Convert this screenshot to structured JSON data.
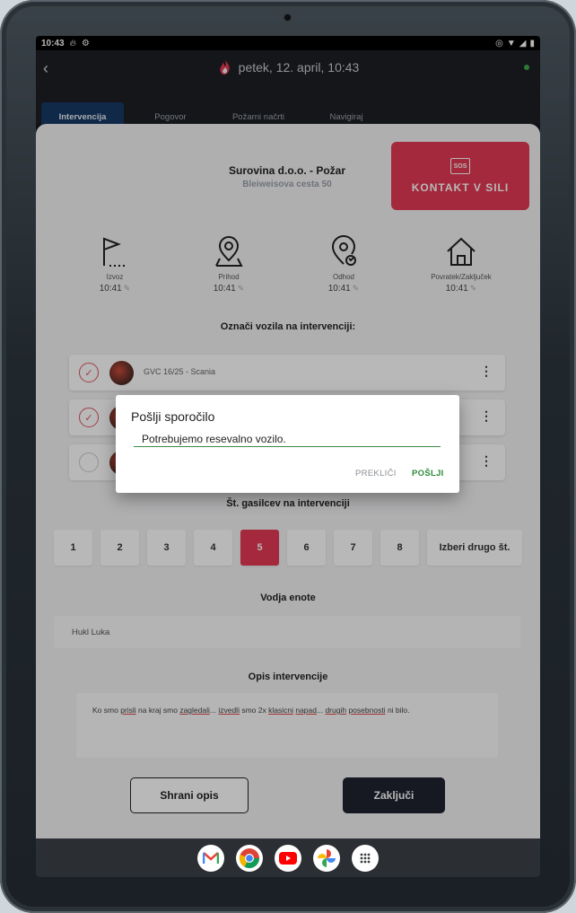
{
  "status_bar": {
    "time": "10:43",
    "left_icons": [
      "flame-icon",
      "settings-icon"
    ],
    "right_icons": [
      "location-icon",
      "wifi-icon",
      "signal-icon",
      "battery-icon"
    ]
  },
  "app_bar": {
    "title": "petek, 12. april, 10:43",
    "online_color": "#3fa84a"
  },
  "tabs": [
    {
      "label": "Intervencija",
      "active": true
    },
    {
      "label": "Pogovor",
      "active": false
    },
    {
      "label": "Požarni načrti",
      "active": false
    },
    {
      "label": "Navigiraj",
      "active": false
    }
  ],
  "incident": {
    "title": "Surovina d.o.o. - Požar",
    "address": "Bleiweisova cesta 50"
  },
  "sos": {
    "badge": "SOS",
    "label": "KONTAKT V SILI",
    "color": "#e33a54"
  },
  "steps": [
    {
      "icon": "flag-icon",
      "label": "Izvoz",
      "time": "10:41"
    },
    {
      "icon": "location-pin-icon",
      "label": "Prihod",
      "time": "10:41"
    },
    {
      "icon": "location-return-icon",
      "label": "Odhod",
      "time": "10:41"
    },
    {
      "icon": "home-icon",
      "label": "Povratek/Zaključek",
      "time": "10:41"
    }
  ],
  "vehicles_heading": "Označi vozila na intervenciji:",
  "vehicles": [
    {
      "name": "GVC 16/25 - Scania",
      "checked": true
    },
    {
      "name": "",
      "checked": true
    },
    {
      "name": "",
      "checked": false
    }
  ],
  "firefighters_heading": "Št. gasilcev na intervenciji",
  "numbers": [
    "1",
    "2",
    "3",
    "4",
    "5",
    "6",
    "7",
    "8"
  ],
  "selected_number": "5",
  "other_number_label": "Izberi drugo št.",
  "leader_heading": "Vodja enote",
  "leader_value": "Hukl Luka",
  "description_heading": "Opis intervencije",
  "description_parts": [
    "Ko smo ",
    "prisli",
    " na kraj smo ",
    "zagledali",
    "... ",
    "izvedli",
    " smo 2x ",
    "klasicni",
    " ",
    "napad",
    "... ",
    "drugih",
    " ",
    "posebnosti",
    " ni bilo."
  ],
  "buttons": {
    "save": "Shrani opis",
    "finish": "Zaključi"
  },
  "dialog": {
    "title": "Pošlji sporočilo",
    "input_value": "Potrebujemo resevalno vozilo.",
    "cancel": "PREKLIČI",
    "send": "POŠLJI"
  },
  "dock_apps": [
    "gmail-icon",
    "chrome-icon",
    "youtube-icon",
    "photos-icon",
    "app-drawer-icon"
  ]
}
